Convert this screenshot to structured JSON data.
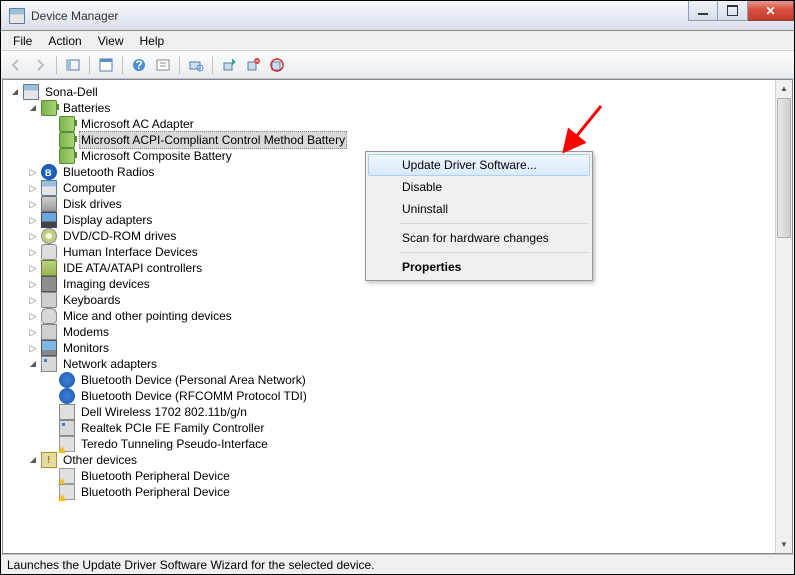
{
  "window": {
    "title": "Device Manager"
  },
  "menu": {
    "file": "File",
    "action": "Action",
    "view": "View",
    "help": "Help"
  },
  "tree": {
    "root": "Sona-Dell",
    "batteries": {
      "label": "Batteries",
      "children": [
        "Microsoft AC Adapter",
        "Microsoft ACPI-Compliant Control Method Battery",
        "Microsoft Composite Battery"
      ]
    },
    "categories": [
      "Bluetooth Radios",
      "Computer",
      "Disk drives",
      "Display adapters",
      "DVD/CD-ROM drives",
      "Human Interface Devices",
      "IDE ATA/ATAPI controllers",
      "Imaging devices",
      "Keyboards",
      "Mice and other pointing devices",
      "Modems",
      "Monitors"
    ],
    "network": {
      "label": "Network adapters",
      "children": [
        "Bluetooth Device (Personal Area Network)",
        "Bluetooth Device (RFCOMM Protocol TDI)",
        "Dell Wireless 1702 802.11b/g/n",
        "Realtek PCIe FE Family Controller",
        "Teredo Tunneling Pseudo-Interface"
      ]
    },
    "other": {
      "label": "Other devices",
      "children": [
        "Bluetooth Peripheral Device",
        "Bluetooth Peripheral Device"
      ]
    }
  },
  "context_menu": {
    "update": "Update Driver Software...",
    "disable": "Disable",
    "uninstall": "Uninstall",
    "scan": "Scan for hardware changes",
    "properties": "Properties"
  },
  "status": "Launches the Update Driver Software Wizard for the selected device."
}
